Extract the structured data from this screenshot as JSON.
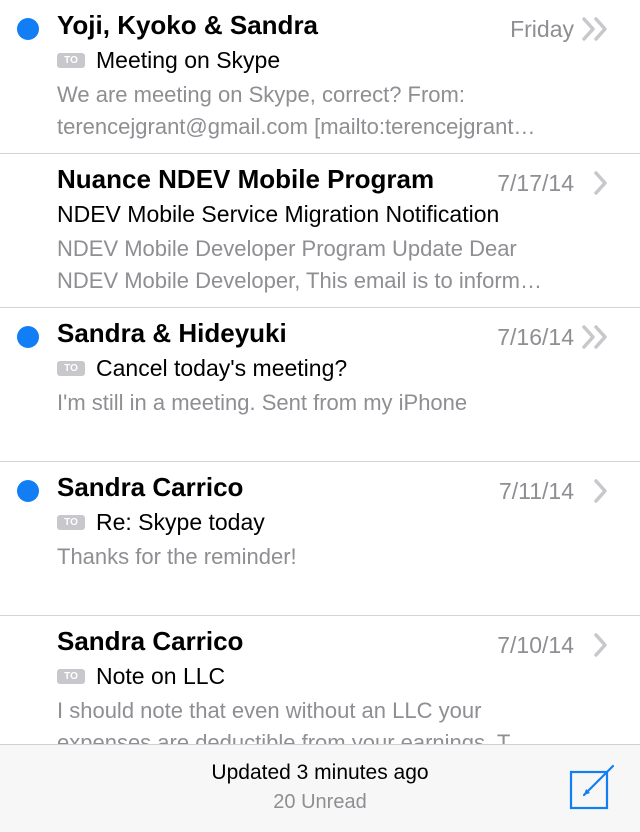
{
  "colors": {
    "accent": "#127ef5",
    "secondary_text": "#8e8e93",
    "badge": "#c7c7cc"
  },
  "messages": [
    {
      "sender": "Yoji, Kyoko & Sandra",
      "date": "Friday",
      "unread": true,
      "thread": true,
      "to_badge": "TO",
      "subject": "Meeting on Skype",
      "preview1": "We are meeting on Skype, correct? From:",
      "preview2": "terencejgrant@gmail.com [mailto:terencejgrant…"
    },
    {
      "sender": "Nuance NDEV Mobile Program",
      "date": "7/17/14",
      "unread": false,
      "thread": false,
      "to_badge": "",
      "subject": "NDEV Mobile Service Migration Notification",
      "preview1": "NDEV Mobile Developer Program Update Dear",
      "preview2": "NDEV Mobile Developer, This email is to inform…"
    },
    {
      "sender": "Sandra & Hideyuki",
      "date": "7/16/14",
      "unread": true,
      "thread": true,
      "to_badge": "TO",
      "subject": "Cancel today's meeting?",
      "preview1": "I'm still in a meeting. Sent from my iPhone",
      "preview2": ""
    },
    {
      "sender": "Sandra Carrico",
      "date": "7/11/14",
      "unread": true,
      "thread": false,
      "to_badge": "TO",
      "subject": "Re: Skype today",
      "preview1": "Thanks for the reminder!",
      "preview2": ""
    },
    {
      "sender": "Sandra Carrico",
      "date": "7/10/14",
      "unread": false,
      "thread": false,
      "to_badge": "TO",
      "subject": "Note on LLC",
      "preview1": "I should note that even without an LLC your",
      "preview2": "expenses are deductible from your earnings. T"
    }
  ],
  "footer": {
    "updated": "Updated 3 minutes ago",
    "unread_count": "20 Unread"
  },
  "icons": {
    "compose": "compose-icon",
    "chevron": "chevron-right-icon",
    "thread": "double-chevron-icon"
  }
}
